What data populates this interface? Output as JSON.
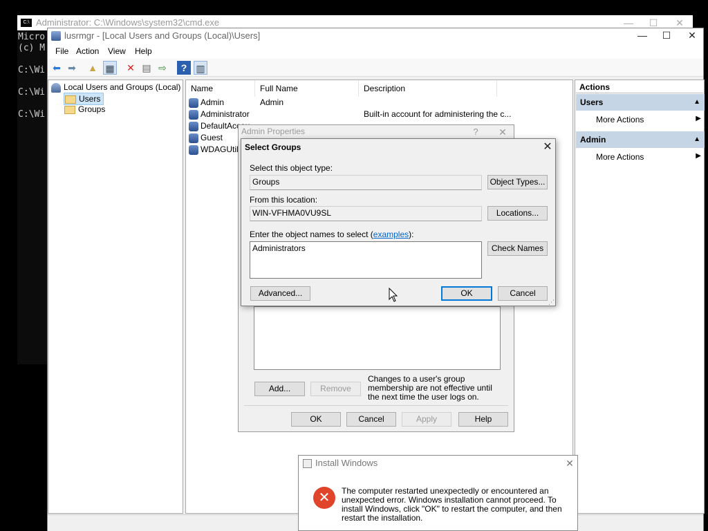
{
  "cmd": {
    "title": "Administrator: C:\\Windows\\system32\\cmd.exe",
    "lines": [
      "Micro",
      "(c) M",
      "",
      "C:\\Wi",
      "",
      "C:\\Wi",
      "",
      "C:\\Wi"
    ]
  },
  "mmc": {
    "title": "lusrmgr - [Local Users and Groups (Local)\\Users]",
    "menu": [
      "File",
      "Action",
      "View",
      "Help"
    ],
    "tree": {
      "root": "Local Users and Groups (Local)",
      "items": [
        "Users",
        "Groups"
      ]
    },
    "list": {
      "columns": [
        "Name",
        "Full Name",
        "Description"
      ],
      "rows": [
        {
          "name": "Admin",
          "full_name": "Admin",
          "description": ""
        },
        {
          "name": "Administrator",
          "full_name": "",
          "description": "Built-in account for administering the c..."
        },
        {
          "name": "DefaultAccou",
          "full_name": "",
          "description": ""
        },
        {
          "name": "Guest",
          "full_name": "",
          "description": ""
        },
        {
          "name": "WDAGUtilit",
          "full_name": "",
          "description": ""
        }
      ]
    },
    "actions": {
      "header": "Actions",
      "sections": [
        {
          "title": "Users",
          "item": "More Actions"
        },
        {
          "title": "Admin",
          "item": "More Actions"
        }
      ]
    }
  },
  "props": {
    "title": "Admin Properties",
    "help_glyph": "?",
    "note": "Changes to a user's group membership are not effective until the next time the user logs on.",
    "add_label": "Add...",
    "remove_label": "Remove",
    "ok_label": "OK",
    "cancel_label": "Cancel",
    "apply_label": "Apply",
    "help_label": "Help"
  },
  "select_groups": {
    "title": "Select Groups",
    "object_type_label": "Select this object type:",
    "object_type_value": "Groups",
    "object_types_button": "Object Types...",
    "location_label": "From this location:",
    "location_value": "WIN-VFHMA0VU9SL",
    "locations_button": "Locations...",
    "names_label_prefix": "Enter the object names to select (",
    "names_label_link": "examples",
    "names_label_suffix": "):",
    "names_value": "Administrators",
    "check_names_button": "Check Names",
    "advanced_button": "Advanced...",
    "ok_button": "OK",
    "cancel_button": "Cancel"
  },
  "install": {
    "title": "Install Windows",
    "message": "The computer restarted unexpectedly or encountered an unexpected error. Windows installation cannot proceed. To install Windows, click \"OK\" to restart the computer, and then restart the installation."
  },
  "colors": {
    "accent": "#0078d7",
    "action_header": "#c6d5e6",
    "error": "#e0452b",
    "link": "#0066cc"
  }
}
